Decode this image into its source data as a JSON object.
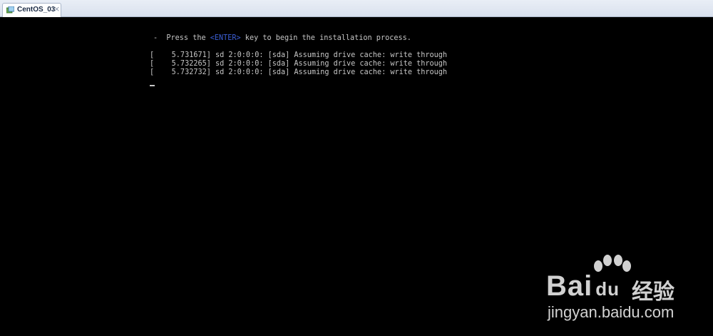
{
  "tab": {
    "title": "CentOS_03",
    "close_symbol": "×",
    "icon": "vm-icon"
  },
  "console": {
    "prompt_prefix": "-  Press the ",
    "enter_key": "<ENTER>",
    "prompt_suffix": " key to begin the installation process.",
    "log_lines": [
      "[    5.731671] sd 2:0:0:0: [sda] Assuming drive cache: write through",
      "[    5.732265] sd 2:0:0:0: [sda] Assuming drive cache: write through",
      "[    5.732732] sd 2:0:0:0: [sda] Assuming drive cache: write through"
    ],
    "colors": {
      "text": "#c6c6c6",
      "enter_key": "#3c5fd6",
      "background": "#000000"
    }
  },
  "watermark": {
    "brand": "Bai",
    "brand_suffix": "du",
    "chinese": "经验",
    "url": "jingyan.baidu.com",
    "icon": "baidu-paw-icon"
  }
}
